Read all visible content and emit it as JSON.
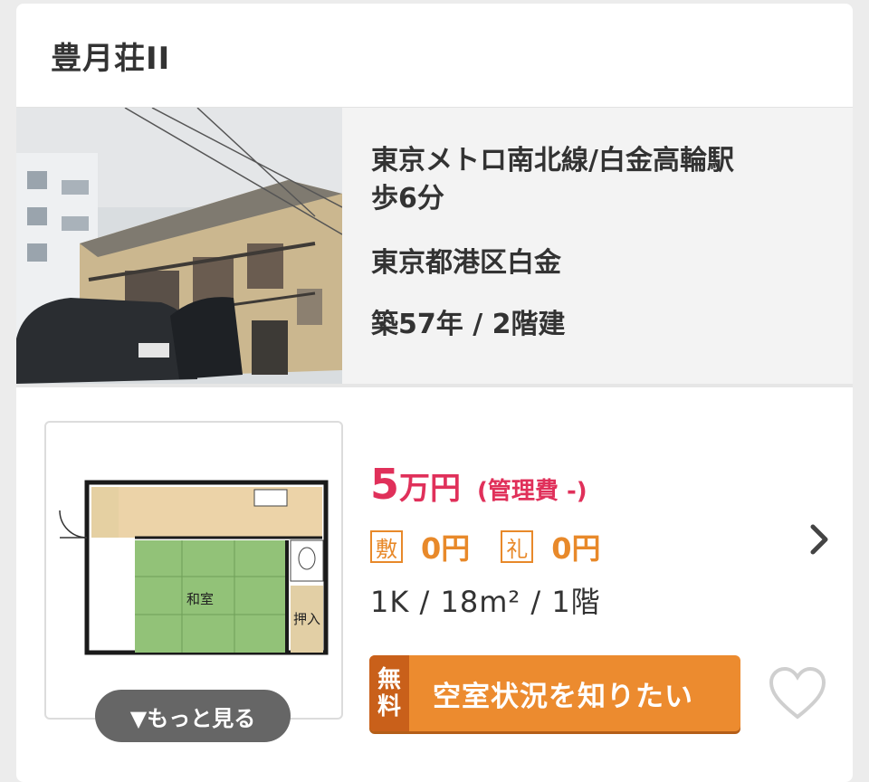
{
  "property": {
    "name": "豊月荘II",
    "access_line1": "東京メトロ南北線/白金高輪駅",
    "access_line2": "歩6分",
    "address": "東京都港区白金",
    "age_floors": "築57年 / 2階建"
  },
  "room": {
    "rent_num": "5",
    "rent_unit": "万円",
    "management_fee": "(管理費 -)",
    "deposit_label": "敷",
    "deposit_value": "0円",
    "key_money_label": "礼",
    "key_money_value": "0円",
    "specs": "1K /  18m² /  1階",
    "floorplan_labels": {
      "washitsu": "和室",
      "oshiire": "押入"
    },
    "more_button": "▼もっと見る",
    "cta_free_top": "無",
    "cta_free_bottom": "料",
    "cta_label": "空室状況を知りたい"
  },
  "icons": [
    "chevron-right-icon",
    "heart-icon"
  ],
  "colors": {
    "rent": "#e0305a",
    "deposit": "#e8892a",
    "cta": "#ec8b2f",
    "cta_free": "#c9601a"
  }
}
